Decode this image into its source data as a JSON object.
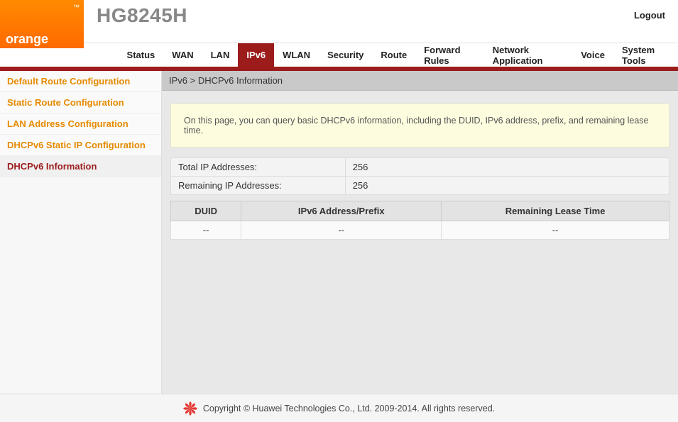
{
  "brand": {
    "logo_text": "orange",
    "tm": "™",
    "model": "HG8245H"
  },
  "logout_label": "Logout",
  "nav": {
    "items": [
      {
        "label": "Status"
      },
      {
        "label": "WAN"
      },
      {
        "label": "LAN"
      },
      {
        "label": "IPv6",
        "active": true
      },
      {
        "label": "WLAN"
      },
      {
        "label": "Security"
      },
      {
        "label": "Route"
      },
      {
        "label": "Forward Rules"
      },
      {
        "label": "Network Application"
      },
      {
        "label": "Voice"
      },
      {
        "label": "System Tools"
      }
    ]
  },
  "sidebar": {
    "items": [
      {
        "label": "Default Route Configuration"
      },
      {
        "label": "Static Route Configuration"
      },
      {
        "label": "LAN Address Configuration"
      },
      {
        "label": "DHCPv6 Static IP Configuration"
      },
      {
        "label": "DHCPv6 Information",
        "active": true
      }
    ]
  },
  "breadcrumb": "IPv6 > DHCPv6 Information",
  "info_banner": "On this page, you can query basic DHCPv6 information, including the DUID, IPv6 address, prefix, and remaining lease time.",
  "summary": {
    "rows": [
      {
        "label": "Total IP Addresses:",
        "value": "256"
      },
      {
        "label": "Remaining IP Addresses:",
        "value": "256"
      }
    ]
  },
  "data_table": {
    "headers": [
      "DUID",
      "IPv6 Address/Prefix",
      "Remaining Lease Time"
    ],
    "rows": [
      [
        "--",
        "--",
        "--"
      ]
    ]
  },
  "footer": {
    "text": "Copyright © Huawei Technologies Co., Ltd. 2009-2014. All rights reserved."
  }
}
